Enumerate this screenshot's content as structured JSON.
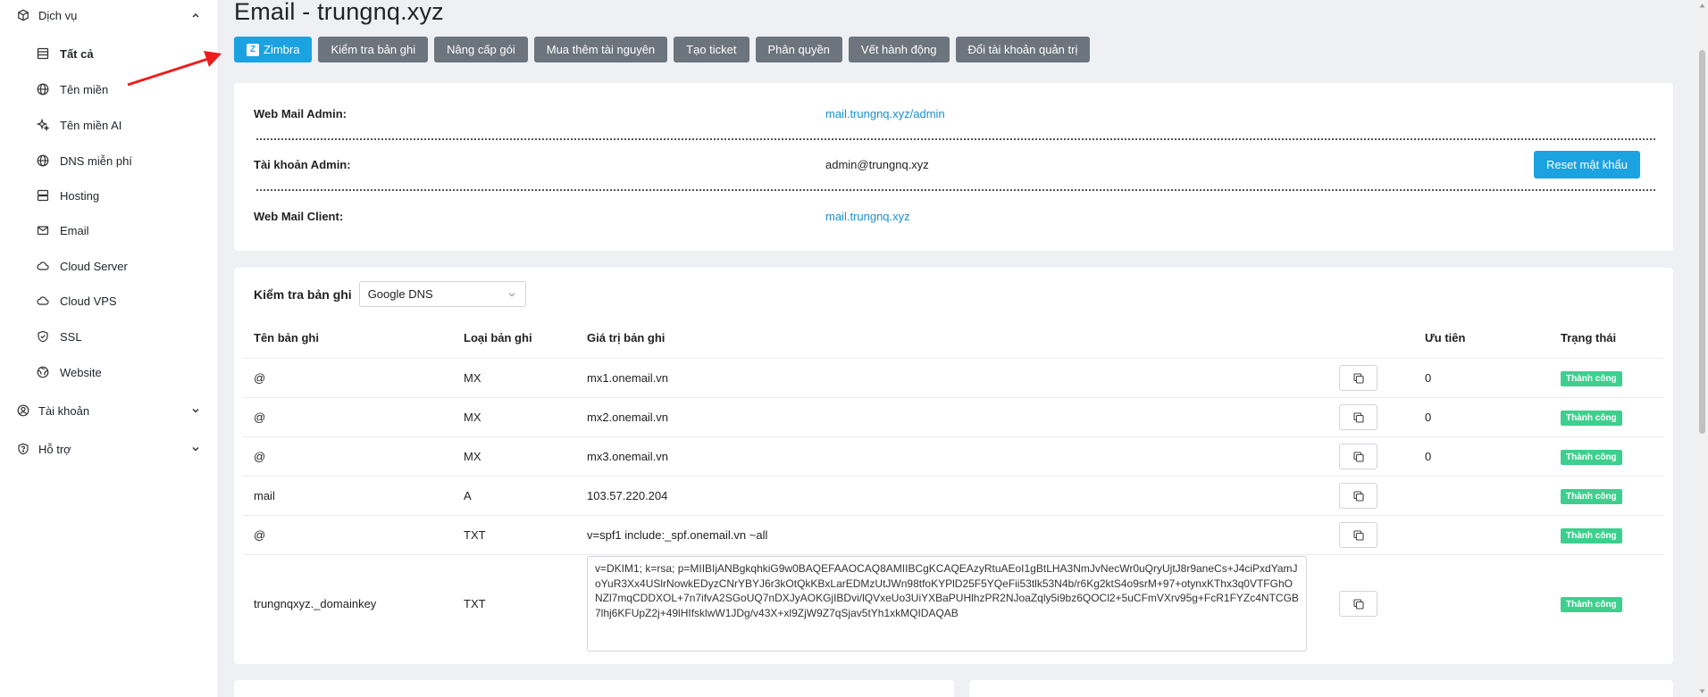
{
  "sidebar": {
    "services": {
      "label": "Dịch vụ"
    },
    "items": [
      {
        "label": "Tất cả",
        "icon": "list-icon"
      },
      {
        "label": "Tên miền",
        "icon": "globe-icon"
      },
      {
        "label": "Tên miền AI",
        "icon": "sparkle-icon"
      },
      {
        "label": "DNS miễn phí",
        "icon": "globe-icon"
      },
      {
        "label": "Hosting",
        "icon": "server-icon"
      },
      {
        "label": "Email",
        "icon": "mail-icon"
      },
      {
        "label": "Cloud Server",
        "icon": "cloud-icon"
      },
      {
        "label": "Cloud VPS",
        "icon": "cloud-icon"
      },
      {
        "label": "SSL",
        "icon": "shield-icon"
      },
      {
        "label": "Website",
        "icon": "globe-icon"
      }
    ],
    "account": {
      "label": "Tài khoản"
    },
    "support": {
      "label": "Hỗ trợ"
    }
  },
  "page": {
    "title": "Email - trungnq.xyz"
  },
  "toolbar": {
    "zimbra": "Zimbra",
    "zimbra_logo": "Z",
    "buttons": [
      "Kiểm tra bản ghi",
      "Nâng cấp gói",
      "Mua thêm tài nguyên",
      "Tạo ticket",
      "Phân quyền",
      "Vết hành động",
      "Đổi tài khoản quản trị"
    ]
  },
  "info": {
    "webmail_admin_label": "Web Mail Admin:",
    "webmail_admin_value": "mail.trungnq.xyz/admin",
    "admin_account_label": "Tài khoản Admin:",
    "admin_account_value": "admin@trungnq.xyz",
    "reset_password": "Reset mật khẩu",
    "webmail_client_label": "Web Mail Client:",
    "webmail_client_value": "mail.trungnq.xyz"
  },
  "dns": {
    "check_label": "Kiểm tra bản ghi",
    "resolver": "Google DNS",
    "headers": {
      "name": "Tên bản ghi",
      "type": "Loại bản ghi",
      "value": "Giá trị bản ghi",
      "priority": "Ưu tiên",
      "status": "Trạng thái"
    },
    "rows": [
      {
        "name": "@",
        "type": "MX",
        "value": "mx1.onemail.vn",
        "priority": "0",
        "status": "Thành công"
      },
      {
        "name": "@",
        "type": "MX",
        "value": "mx2.onemail.vn",
        "priority": "0",
        "status": "Thành công"
      },
      {
        "name": "@",
        "type": "MX",
        "value": "mx3.onemail.vn",
        "priority": "0",
        "status": "Thành công"
      },
      {
        "name": "mail",
        "type": "A",
        "value": "103.57.220.204",
        "priority": "",
        "status": "Thành công"
      },
      {
        "name": "@",
        "type": "TXT",
        "value": "v=spf1 include:_spf.onemail.vn ~all",
        "priority": "",
        "status": "Thành công"
      },
      {
        "name": "trungnqxyz._domainkey",
        "type": "TXT",
        "value": "v=DKIM1; k=rsa; p=MIIBIjANBgkqhkiG9w0BAQEFAAOCAQ8AMIIBCgKCAQEAzyRtuAEoI1gBtLHA3NmJvNecWr0uQryUjtJ8r9aneCs+J4ciPxdYamJoYuR3Xx4USlrNowkEDyzCNrYBYJ6r3kOtQkKBxLarEDMzUtJWn98tfoKYPlD25F5YQeFii53tlk53N4b/r6Kg2ktS4o9srM+97+otynxKThx3q0VTFGhONZl7mqCDDXOL+7n7ifvA2SGoUQ7nDXJyAOKGjIBDvi/lQVxeUo3UiYXBaPUHlhzPR2NJoaZqly5i9bz6QOCl2+5uCFmVXrv95g+FcR1FYZc4NTCGB7lhj6KFUpZ2j+49lHIfsklwW1JDg/v43X+xl9ZjW9Z7qSjav5tYh1xkMQIDAQAB",
        "priority": "",
        "status": "Thành công"
      }
    ]
  },
  "colors": {
    "primary": "#1ba2e0",
    "secondary": "#6c757d",
    "success": "#3ecf8e",
    "link": "#1a8fd0"
  }
}
